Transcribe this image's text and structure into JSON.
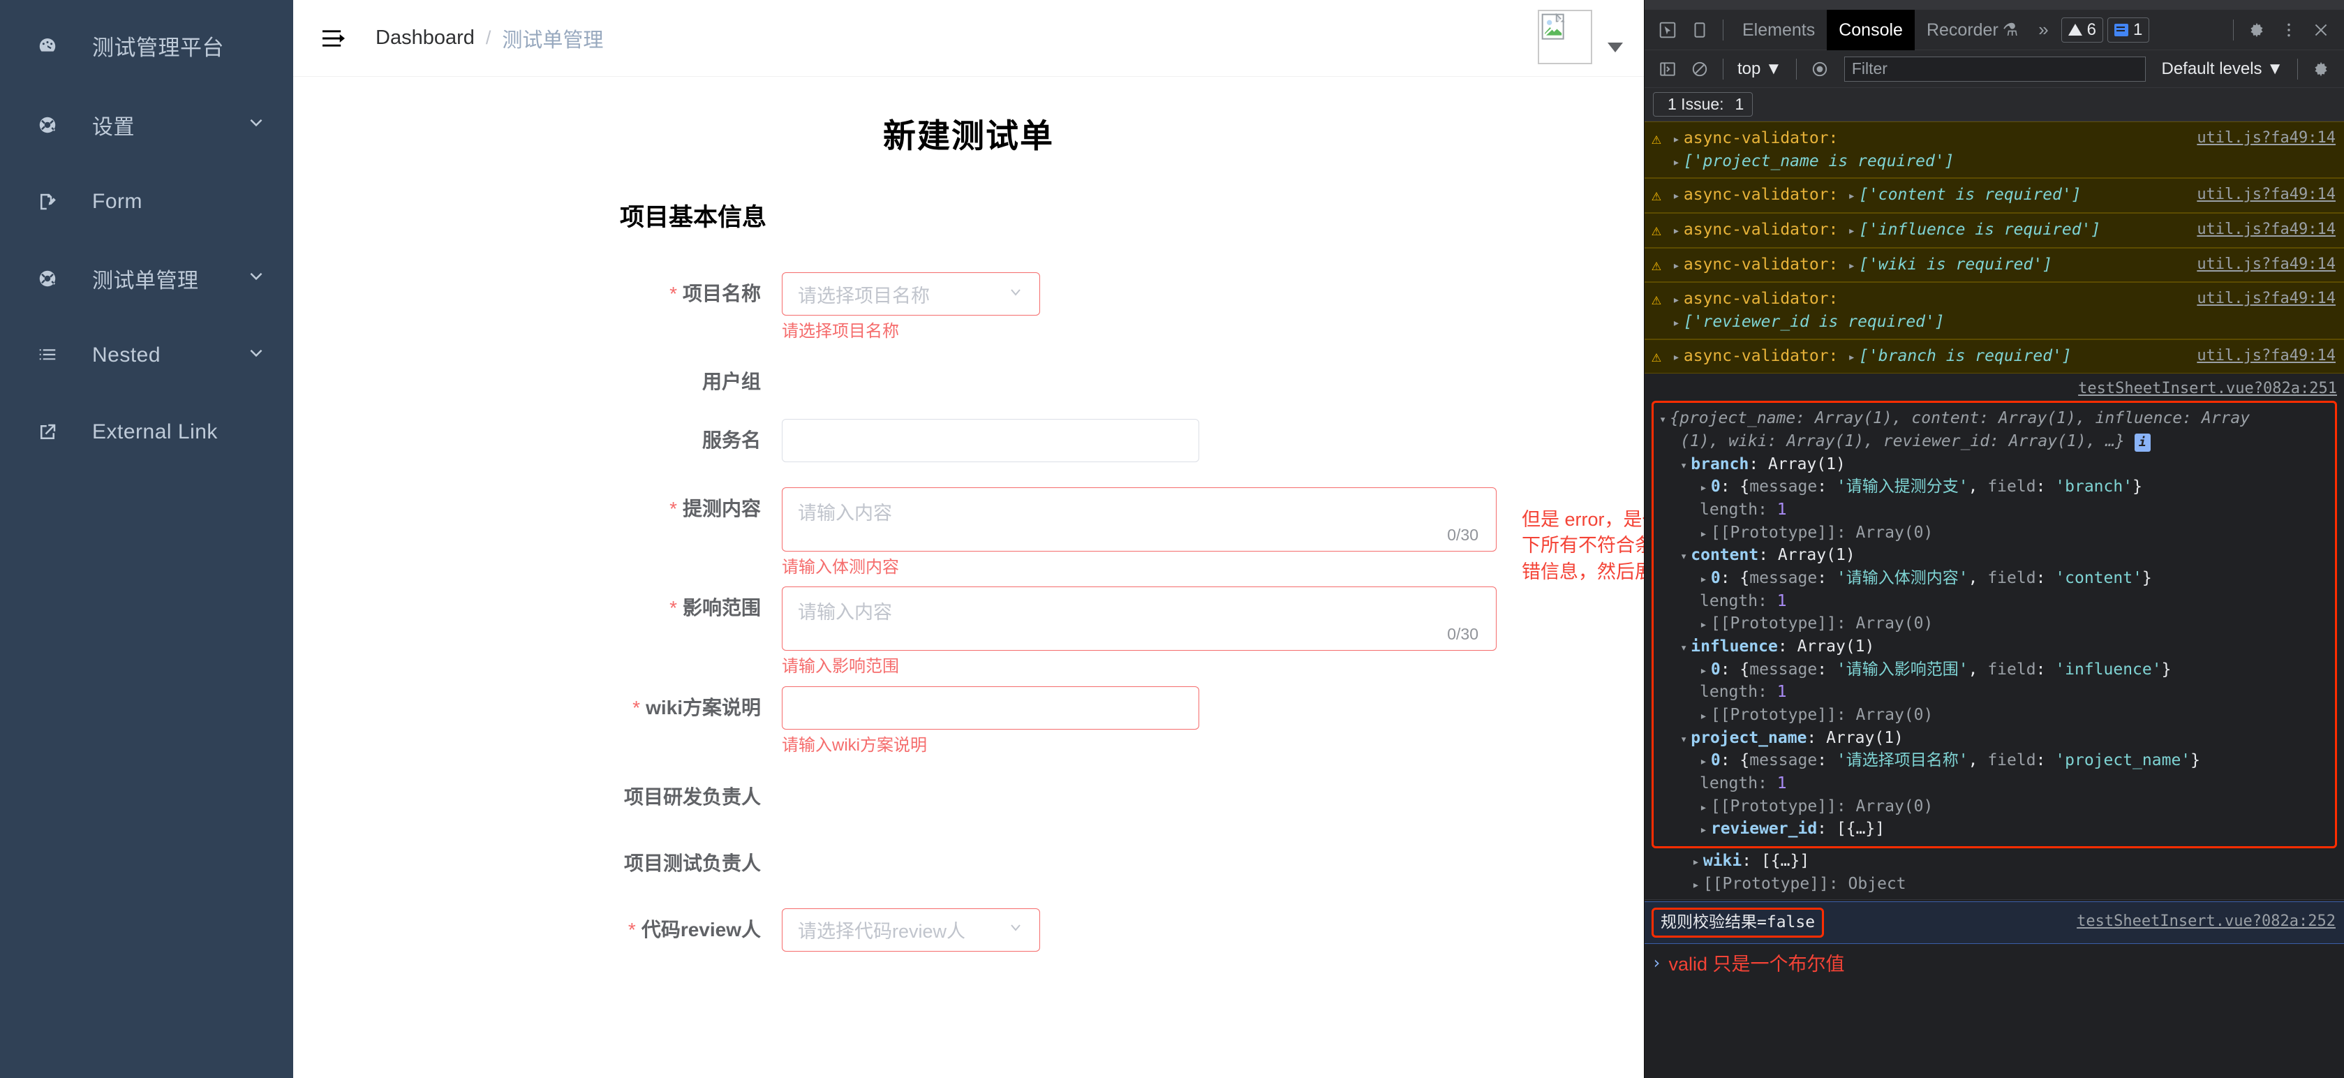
{
  "sidebar": {
    "items": [
      {
        "label": "测试管理平台",
        "icon": "dashboard-icon",
        "caret": false
      },
      {
        "label": "设置",
        "icon": "gear-icon",
        "caret": true
      },
      {
        "label": "Form",
        "icon": "form-icon",
        "caret": false
      },
      {
        "label": "测试单管理",
        "icon": "gear-icon",
        "caret": true
      },
      {
        "label": "Nested",
        "icon": "list-icon",
        "caret": true
      },
      {
        "label": "External Link",
        "icon": "external-link-icon",
        "caret": false
      }
    ]
  },
  "navbar": {
    "breadcrumb_current": "Dashboard",
    "breadcrumb_separator": "/",
    "breadcrumb_link": "测试单管理"
  },
  "page": {
    "title": "新建测试单",
    "section_title": "项目基本信息",
    "annotation": "但是 error，是一个数组，里面返回了这个表单下所有不符合条件的，就可以从这里面获取报错信息，然后展示在 message 中"
  },
  "form": {
    "fields": [
      {
        "label": "项目名称",
        "required": true,
        "type": "select",
        "error": true,
        "placeholder": "请选择项目名称",
        "error_message": "请选择项目名称"
      },
      {
        "label": "用户组",
        "required": false,
        "type": "none",
        "error": false,
        "placeholder": "",
        "error_message": ""
      },
      {
        "label": "服务名",
        "required": false,
        "type": "input",
        "error": false,
        "placeholder": "",
        "error_message": ""
      },
      {
        "label": "提测内容",
        "required": true,
        "type": "textarea",
        "error": true,
        "placeholder": "请输入内容",
        "counter": "0/30",
        "error_message": "请输入体测内容"
      },
      {
        "label": "影响范围",
        "required": true,
        "type": "textarea",
        "error": true,
        "placeholder": "请输入内容",
        "counter": "0/30",
        "error_message": "请输入影响范围"
      },
      {
        "label": "wiki方案说明",
        "required": true,
        "type": "input",
        "error": true,
        "placeholder": "",
        "error_message": "请输入wiki方案说明"
      },
      {
        "label": "项目研发负责人",
        "required": false,
        "type": "none",
        "error": false,
        "placeholder": "",
        "error_message": ""
      },
      {
        "label": "项目测试负责人",
        "required": false,
        "type": "none",
        "error": false,
        "placeholder": "",
        "error_message": ""
      },
      {
        "label": "代码review人",
        "required": true,
        "type": "select",
        "error": true,
        "placeholder": "请选择代码review人",
        "error_message": ""
      }
    ]
  },
  "devtools": {
    "tabs": [
      {
        "label": "Elements",
        "active": false
      },
      {
        "label": "Console",
        "active": true
      },
      {
        "label": "Recorder",
        "active": false,
        "suffix": "⚗"
      }
    ],
    "overflow_chevron": "»",
    "warning_count": "6",
    "message_count": "1",
    "filter_placeholder": "Filter",
    "context_selector": "top",
    "levels_selector": "Default levels",
    "issue_bar": {
      "text": "1 Issue:",
      "count": "1"
    }
  },
  "console": {
    "warnings": [
      {
        "label": "async-validator:",
        "value": "['project_name is required']",
        "source": "util.js?fa49:14",
        "wrapped": true
      },
      {
        "label": "async-validator:",
        "value": "['content is required']",
        "source": "util.js?fa49:14",
        "wrapped": false
      },
      {
        "label": "async-validator:",
        "value": "['influence is required']",
        "source": "util.js?fa49:14",
        "wrapped": false
      },
      {
        "label": "async-validator:",
        "value": "['wiki is required']",
        "source": "util.js?fa49:14",
        "wrapped": false
      },
      {
        "label": "async-validator:",
        "value": "['reviewer_id is required']",
        "source": "util.js?fa49:14",
        "wrapped": true
      },
      {
        "label": "async-validator:",
        "value": "['branch is required']",
        "source": "util.js?fa49:14",
        "wrapped": false
      }
    ],
    "object_log": {
      "source": "testSheetInsert.vue?082a:251",
      "summary_line1": "{project_name: Array(1), content: Array(1), influence: Array",
      "summary_line2": "(1), wiki: Array(1), reviewer_id: Array(1), …}",
      "groups": [
        {
          "key": "branch",
          "type": "Array(1)",
          "item": "0: {message: '请输入提测分支', field: 'branch'}",
          "message": "请输入提测分支",
          "field": "branch",
          "length_label": "length:",
          "length_value": "1",
          "proto": "[[Prototype]]: Array(0)"
        },
        {
          "key": "content",
          "type": "Array(1)",
          "item": "0: {message: '请输入体测内容', field: 'content'}",
          "message": "请输入体测内容",
          "field": "content",
          "length_label": "length:",
          "length_value": "1",
          "proto": "[[Prototype]]: Array(0)"
        },
        {
          "key": "influence",
          "type": "Array(1)",
          "item": "0: {message: '请输入影响范围', field: 'influence'}",
          "message": "请输入影响范围",
          "field": "influence",
          "length_label": "length:",
          "length_value": "1",
          "proto": "[[Prototype]]: Array(0)"
        },
        {
          "key": "project_name",
          "type": "Array(1)",
          "item": "0: {message: '请选择项目名称', field: 'project_name'}",
          "message": "请选择项目名称",
          "field": "project_name",
          "length_label": "length:",
          "length_value": "1",
          "proto": "[[Prototype]]: Array(0)"
        }
      ],
      "collapsed": [
        {
          "key": "reviewer_id",
          "value": "[{…}]"
        },
        {
          "key": "wiki",
          "value": "[{…}]"
        }
      ],
      "proto_object": "[[Prototype]]: Object"
    },
    "result": {
      "text": "规则校验结果=false",
      "source": "testSheetInsert.vue?082a:252"
    },
    "prompt_annotation": "valid 只是一个布尔值"
  }
}
